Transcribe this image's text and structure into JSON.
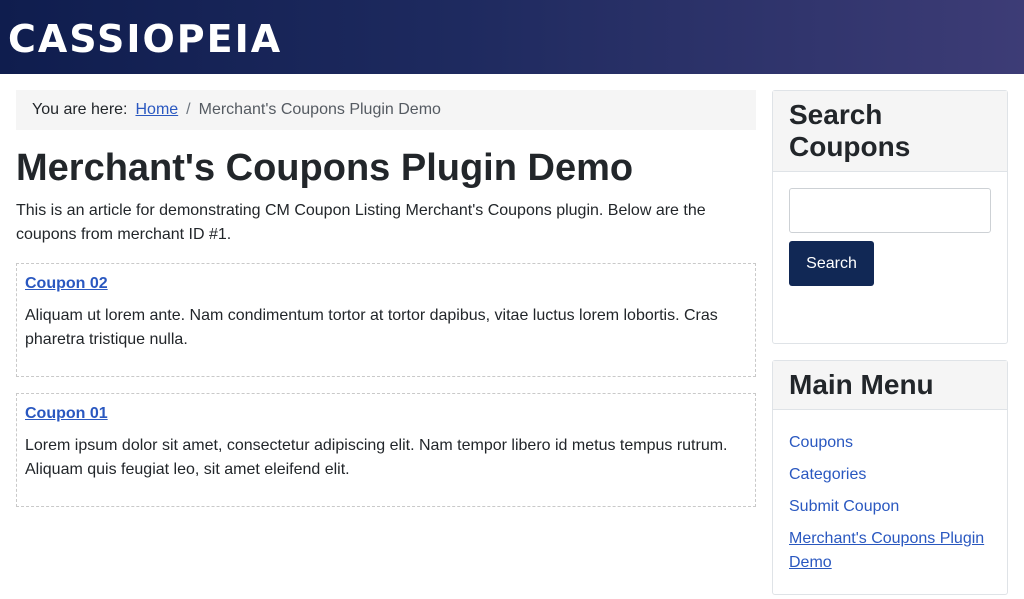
{
  "header": {
    "brand": "CASSIOPEIA"
  },
  "breadcrumb": {
    "label": "You are here:",
    "home": "Home",
    "separator": "/",
    "current": "Merchant's Coupons Plugin Demo"
  },
  "article": {
    "title": "Merchant's Coupons Plugin Demo",
    "intro": "This is an article for demonstrating CM Coupon Listing Merchant's Coupons plugin. Below are the coupons from merchant ID #1.",
    "coupons": [
      {
        "title": "Coupon 02",
        "description": "Aliquam ut lorem ante. Nam condimentum tortor at tortor dapibus, vitae luctus lorem lobortis. Cras pharetra tristique nulla."
      },
      {
        "title": "Coupon 01",
        "description": "Lorem ipsum dolor sit amet, consectetur adipiscing elit. Nam tempor libero id metus tempus rutrum. Aliquam quis feugiat leo, sit amet eleifend elit."
      }
    ]
  },
  "search": {
    "title": "Search Coupons",
    "input_value": "",
    "button_label": "Search"
  },
  "main_menu": {
    "title": "Main Menu",
    "items": [
      {
        "label": "Coupons"
      },
      {
        "label": "Categories"
      },
      {
        "label": "Submit Coupon"
      },
      {
        "label": "Merchant's Coupons Plugin Demo"
      }
    ]
  },
  "colors": {
    "header_gradient_start": "#0f1d4e",
    "header_gradient_end": "#3d3c76",
    "link": "#2a58c0",
    "button": "#112855"
  }
}
